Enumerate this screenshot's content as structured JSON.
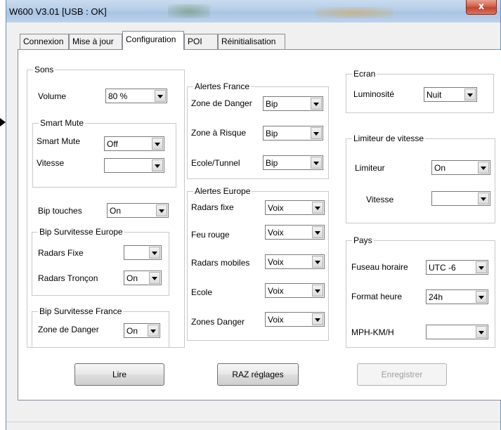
{
  "window": {
    "title": "W600 V3.01 [USB : OK]",
    "close_glyph": "x"
  },
  "tabs": [
    {
      "label": "Connexion"
    },
    {
      "label": "Mise à jour"
    },
    {
      "label": "Configuration",
      "active": true
    },
    {
      "label": "POI"
    },
    {
      "label": "Réinitialisation"
    }
  ],
  "sons": {
    "title": "Sons",
    "volume_label": "Volume",
    "volume_value": "80 %",
    "smart_mute": {
      "title": "Smart Mute",
      "smart_mute_label": "Smart Mute",
      "smart_mute_value": "Off",
      "vitesse_label": "Vitesse",
      "vitesse_value": ""
    },
    "bip_touches_label": "Bip touches",
    "bip_touches_value": "On",
    "bip_europe": {
      "title": "Bip Survitesse Europe",
      "radars_fixe_label": "Radars Fixe",
      "radars_fixe_value": "",
      "radars_troncon_label": "Radars Tronçon",
      "radars_troncon_value": "On"
    },
    "bip_france": {
      "title": "Bip Survitesse France",
      "zone_danger_label": "Zone de Danger",
      "zone_danger_value": "On"
    }
  },
  "alertes_france": {
    "title": "Alertes France",
    "zone_danger_label": "Zone de Danger",
    "zone_danger_value": "Bip",
    "zone_risque_label": "Zone à Risque",
    "zone_risque_value": "Bip",
    "ecole_tunnel_label": "Ecole/Tunnel",
    "ecole_tunnel_value": "Bip"
  },
  "alertes_europe": {
    "title": "Alertes Europe",
    "radars_fixe_label": "Radars fixe",
    "radars_fixe_value": "Voix",
    "feu_rouge_label": "Feu rouge",
    "feu_rouge_value": "Voix",
    "radars_mobiles_label": "Radars mobiles",
    "radars_mobiles_value": "Voix",
    "ecole_label": "Ecole",
    "ecole_value": "Voix",
    "zones_danger_label": "Zones Danger",
    "zones_danger_value": "Voix"
  },
  "ecran": {
    "title": "Ecran",
    "luminosite_label": "Luminosité",
    "luminosite_value": "Nuit"
  },
  "limiteur": {
    "title": "Limiteur de vitesse",
    "limiteur_label": "Limiteur",
    "limiteur_value": "On",
    "vitesse_label": "Vitesse",
    "vitesse_value": ""
  },
  "pays": {
    "title": "Pays",
    "fuseau_label": "Fuseau horaire",
    "fuseau_value": "UTC -6",
    "format_label": "Format heure",
    "format_value": "24h",
    "unit_label": "MPH-KM/H",
    "unit_value": ""
  },
  "buttons": {
    "lire": "Lire",
    "raz": "RAZ réglages",
    "enregistrer": "Enregistrer"
  },
  "colors": {
    "title_bar": "#b5cde8",
    "close": "#c4442e",
    "window_bg": "#f0f0f0"
  }
}
